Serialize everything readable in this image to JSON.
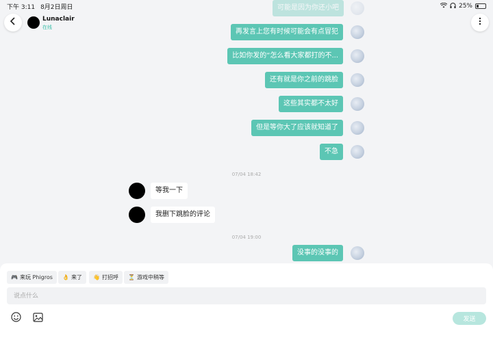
{
  "status_bar": {
    "time": "下午 3:11",
    "date": "8月2日周日",
    "battery": "25%"
  },
  "header": {
    "contact_name": "Lunaclair",
    "contact_status": "在线"
  },
  "messages_top_faded": "可能是因为你还小吧",
  "messages_out_1": [
    "再发言上您有时候可能会有点冒犯",
    "比如你发的“怎么看大家都打的不...",
    "还有就是你之前的跳脸",
    "这些其实都不太好",
    "但是等你大了应该就知道了",
    "不急"
  ],
  "time_1": "07/04 18:42",
  "messages_in": [
    "等我一下",
    "我删下跳脸的评论"
  ],
  "time_2": "07/04 19:00",
  "messages_out_2": [
    "没事的没事的"
  ],
  "quick_replies": [
    {
      "icon": "🎮",
      "label": "来玩 Phigros"
    },
    {
      "icon": "👌",
      "label": "来了"
    },
    {
      "icon": "👋",
      "label": "打招呼"
    },
    {
      "icon": "⏳",
      "label": "游戏中稍等"
    }
  ],
  "composer": {
    "placeholder": "说点什么",
    "send_label": "发送"
  },
  "colors": {
    "accent": "#5cc6b4",
    "send_disabled": "#b7e6de",
    "online": "#3dbfa8"
  }
}
